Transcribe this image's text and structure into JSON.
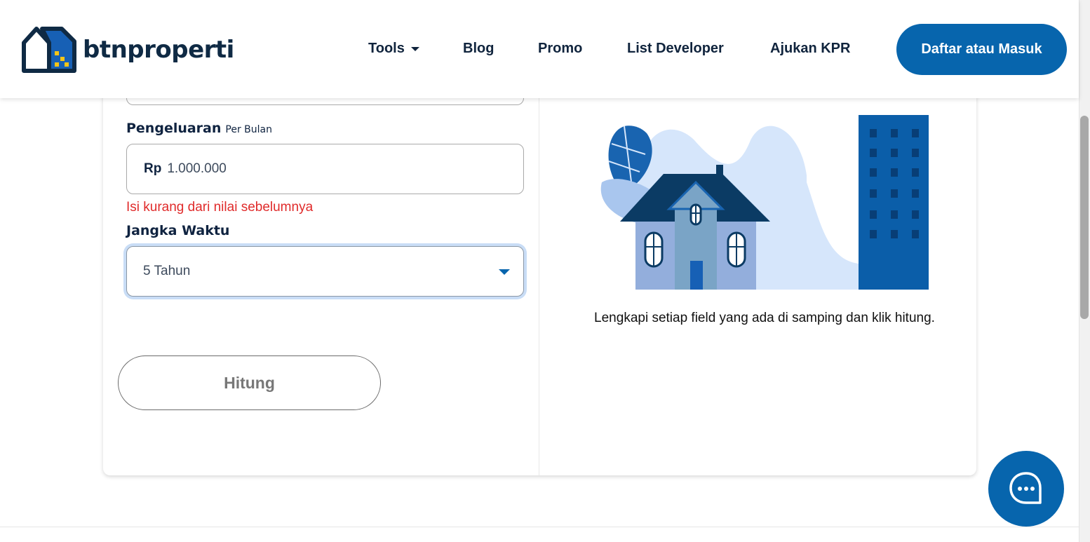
{
  "header": {
    "logo_text": "btnproperti",
    "nav": [
      {
        "label": "Tools",
        "has_dropdown": true
      },
      {
        "label": "Blog"
      },
      {
        "label": "Promo"
      },
      {
        "label": "List Developer"
      },
      {
        "label": "Ajukan KPR"
      }
    ],
    "login_button": "Daftar atau Masuk"
  },
  "form": {
    "pengeluaran": {
      "label": "Pengeluaran",
      "sublabel": "Per Bulan",
      "currency": "Rp",
      "value": "1.000.000",
      "error": "Isi kurang dari nilai sebelumnya"
    },
    "jangka_waktu": {
      "label": "Jangka Waktu",
      "selected": "5 Tahun"
    },
    "submit_label": "Hitung"
  },
  "result": {
    "hint": "Lengkapi setiap field yang ada di samping dan klik hitung."
  },
  "colors": {
    "primary": "#0765ad",
    "navy": "#0f2a44",
    "error": "#e02b2b",
    "accent_yellow": "#f5c518"
  },
  "icons": {
    "chat": "chat-bubble-icon",
    "dropdown": "caret-down-icon",
    "logo": "house-logo-icon"
  }
}
